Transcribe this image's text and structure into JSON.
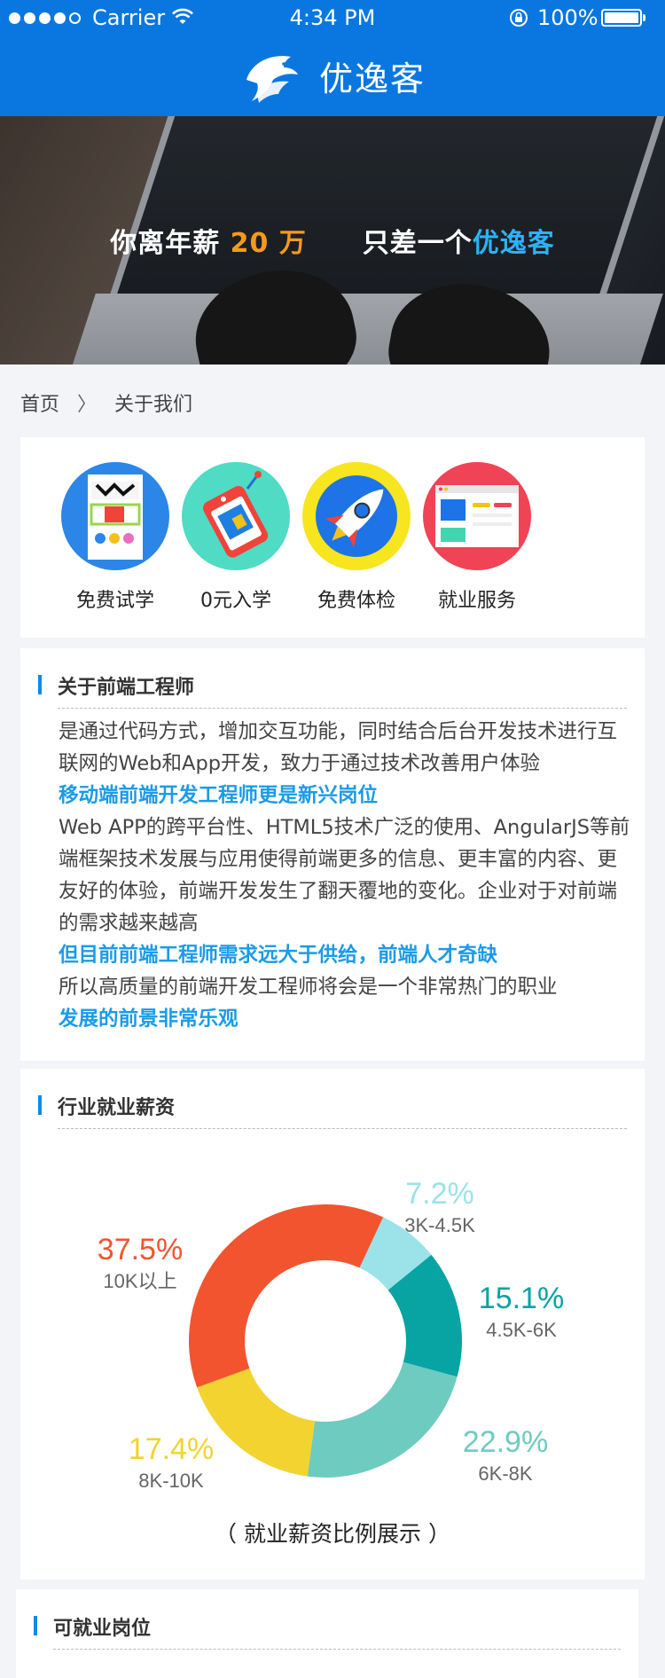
{
  "status_bar": {
    "carrier": "Carrier",
    "time": "4:34 PM",
    "battery": "100%"
  },
  "header": {
    "brand": "优逸客"
  },
  "banner": {
    "part1": "你离年薪",
    "salary": "20 万",
    "part2": "只差一个",
    "brand": "优逸客"
  },
  "breadcrumb": {
    "home": "首页",
    "separator": "〉",
    "current": "关于我们"
  },
  "features": [
    {
      "label": "免费试学",
      "icon": "trial-icon",
      "color": "#2b86e8"
    },
    {
      "label": "0元入学",
      "icon": "tag-icon",
      "color": "#4fdbc4"
    },
    {
      "label": "免费体检",
      "icon": "rocket-icon",
      "color": "#f7e51f"
    },
    {
      "label": "就业服务",
      "icon": "browser-icon",
      "color": "#f04355"
    }
  ],
  "about": {
    "title": "关于前端工程师",
    "p1": "是通过代码方式，增加交互功能，同时结合后台开发技术进行互联网的Web和App开发，致力于通过技术改善用户体验",
    "h1": "移动端前端开发工程师更是新兴岗位",
    "p2": "Web APP的跨平台性、HTML5技术广泛的使用、AngularJS等前端框架技术发展与应用使得前端更多的信息、更丰富的内容、更友好的体验，前端开发发生了翻天覆地的变化。企业对于对前端的需求越来越高",
    "h2": "但目前前端工程师需求远大于供给，前端人才奇缺",
    "p3": "所以高质量的前端开发工程师将会是一个非常热门的职业",
    "h3": "发展的前景非常乐观"
  },
  "salary": {
    "title": "行业就业薪资",
    "caption": "（ 就业薪资比例展示 ）"
  },
  "chart_data": {
    "type": "pie",
    "donut": true,
    "legend": "none",
    "slices": [
      {
        "label": "3K-4.5K",
        "value": 7.2,
        "pct_text": "7.2%",
        "color": "#9be3e8"
      },
      {
        "label": "4.5K-6K",
        "value": 15.1,
        "pct_text": "15.1%",
        "color": "#08a3a3"
      },
      {
        "label": "6K-8K",
        "value": 22.9,
        "pct_text": "22.9%",
        "color": "#6ecbbf"
      },
      {
        "label": "8K-10K",
        "value": 17.4,
        "pct_text": "17.4%",
        "color": "#f2d330"
      },
      {
        "label": "10K以上",
        "value": 37.5,
        "pct_text": "37.5%",
        "color": "#f2542f"
      }
    ]
  },
  "positions": {
    "title": "可就业岗位"
  }
}
